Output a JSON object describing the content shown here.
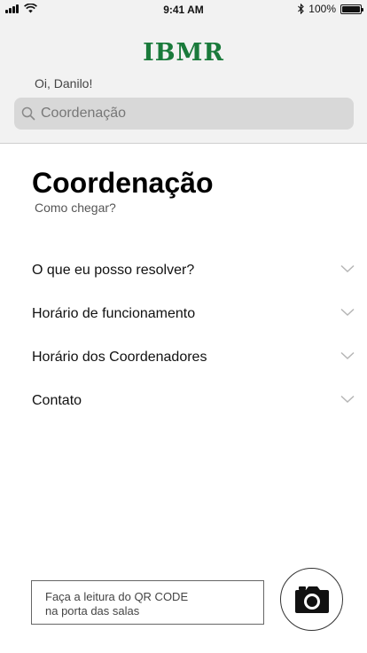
{
  "status_bar": {
    "time": "9:41 AM",
    "battery": "100%",
    "battery_level": 1.0
  },
  "header": {
    "logo": "IBMR",
    "greeting": "Oi, Danilo!",
    "logo_color": "#1a7a3b"
  },
  "search": {
    "placeholder": "Coordenação"
  },
  "main": {
    "title": "Coordenação",
    "subtitle": "Como chegar?",
    "sections": [
      {
        "label": "O que eu posso resolver?"
      },
      {
        "label": "Horário de funcionamento"
      },
      {
        "label": "Horário dos Coordenadores"
      },
      {
        "label": "Contato"
      }
    ]
  },
  "footer": {
    "qr_line1": "Faça a leitura do QR CODE",
    "qr_line2": "na porta das salas",
    "camera_icon": "camera-icon"
  }
}
